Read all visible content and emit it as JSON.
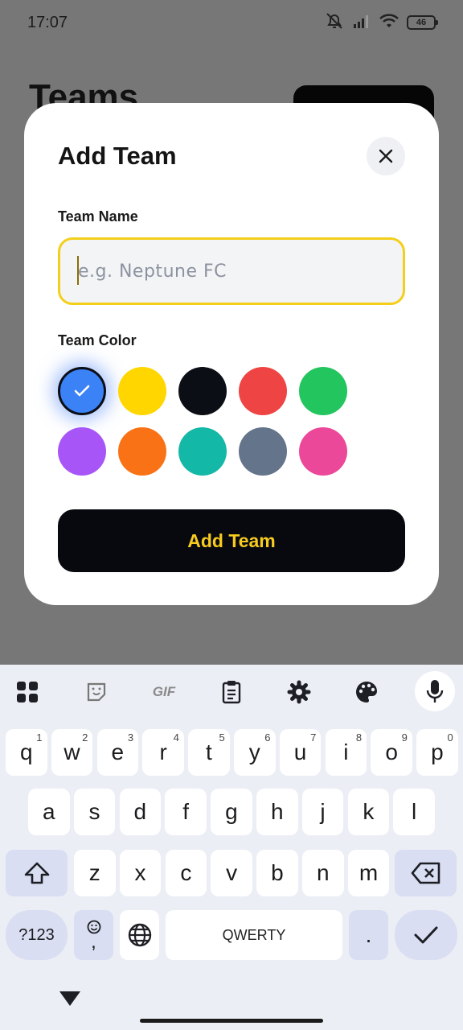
{
  "status_bar": {
    "time": "17:07",
    "battery": "46"
  },
  "background": {
    "title": "Teams"
  },
  "modal": {
    "title": "Add Team",
    "team_name_label": "Team Name",
    "team_name_placeholder": "e.g. Neptune FC",
    "team_name_value": "",
    "team_color_label": "Team Color",
    "colors": [
      "#3b82f6",
      "#ffd600",
      "#0b0e14",
      "#ef4444",
      "#22c55e",
      "#a855f7",
      "#f97316",
      "#14b8a6",
      "#64748b",
      "#ec4899"
    ],
    "selected_color": "#3b82f6",
    "submit_label": "Add Team"
  },
  "keyboard": {
    "toolbar": [
      "apps-icon",
      "sticker-icon",
      "gif-icon",
      "clipboard-icon",
      "settings-icon",
      "palette-icon",
      "mic-icon"
    ],
    "gif_label": "GIF",
    "row1": [
      {
        "k": "q",
        "h": "1"
      },
      {
        "k": "w",
        "h": "2"
      },
      {
        "k": "e",
        "h": "3"
      },
      {
        "k": "r",
        "h": "4"
      },
      {
        "k": "t",
        "h": "5"
      },
      {
        "k": "y",
        "h": "6"
      },
      {
        "k": "u",
        "h": "7"
      },
      {
        "k": "i",
        "h": "8"
      },
      {
        "k": "o",
        "h": "9"
      },
      {
        "k": "p",
        "h": "0"
      }
    ],
    "row2": [
      "a",
      "s",
      "d",
      "f",
      "g",
      "h",
      "j",
      "k",
      "l"
    ],
    "row3": [
      "z",
      "x",
      "c",
      "v",
      "b",
      "n",
      "m"
    ],
    "symbols_label": "?123",
    "emoji_comma": ",",
    "space_label": "QWERTY",
    "period": "."
  }
}
